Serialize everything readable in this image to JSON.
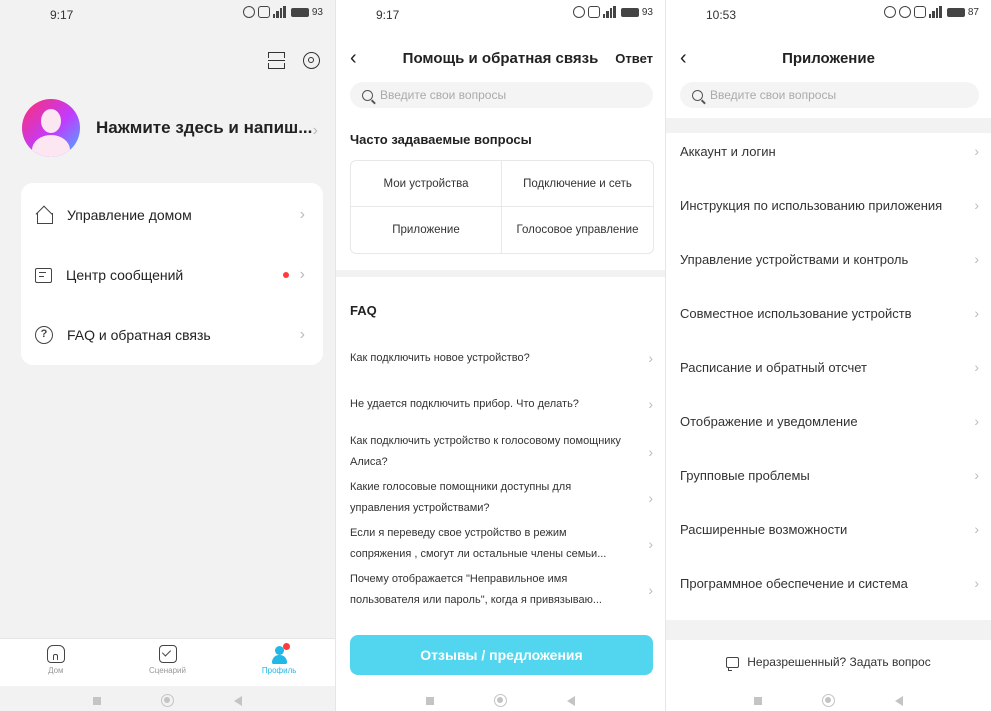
{
  "screen1": {
    "status": {
      "time": "9:17",
      "battery": "93"
    },
    "profile_name": "Нажмите здесь и напиш...",
    "menu": [
      {
        "label": "Управление домом"
      },
      {
        "label": "Центр сообщений"
      },
      {
        "label": "FAQ и обратная связь"
      }
    ],
    "faq_glyph": "?",
    "tabs": [
      {
        "label": "Дом"
      },
      {
        "label": "Сценарий"
      },
      {
        "label": "Профиль"
      }
    ],
    "colors": {
      "accent": "#22b8e6",
      "badge": "#ff3b3b"
    }
  },
  "screen2": {
    "status": {
      "time": "9:17",
      "battery": "93"
    },
    "title": "Помощь и обратная связь",
    "action": "Ответ",
    "search_placeholder": "Введите свои вопросы",
    "faq_section": "Часто задаваемые вопросы",
    "categories": [
      "Мои устройства",
      "Подключение и сеть",
      "Приложение",
      "Голосовое управление"
    ],
    "faq_title": "FAQ",
    "questions": [
      "Как подключить новое устройство?",
      "Не удается подключить прибор. Что делать?",
      "Как подключить устройство к голосовому помощнику Алиса?",
      "Какие голосовые помощники доступны для управления устройствами?",
      "Если я переведу свое устройство в режим сопряжения , смогут ли остальные члены семьи...",
      "Почему отображается \"Неправильное имя пользователя или пароль\", когда я привязываю..."
    ],
    "submit_label": "Отзывы / предложения",
    "colors": {
      "submit": "#52d5ef"
    }
  },
  "screen3": {
    "status": {
      "time": "10:53",
      "battery": "87"
    },
    "title": "Приложение",
    "search_placeholder": "Введите свои вопросы",
    "items": [
      "Аккаунт и логин",
      "Инструкция по использованию приложения",
      "Управление устройствами и контроль",
      "Совместное использование устройств",
      "Расписание и обратный отсчет",
      "Отображение и уведомление",
      "Групповые проблемы",
      "Расширенные возможности",
      "Программное обеспечение и система"
    ],
    "ask_label": "Неразрешенный? Задать вопрос"
  },
  "icons": {
    "chevron": "›",
    "back": "‹"
  }
}
